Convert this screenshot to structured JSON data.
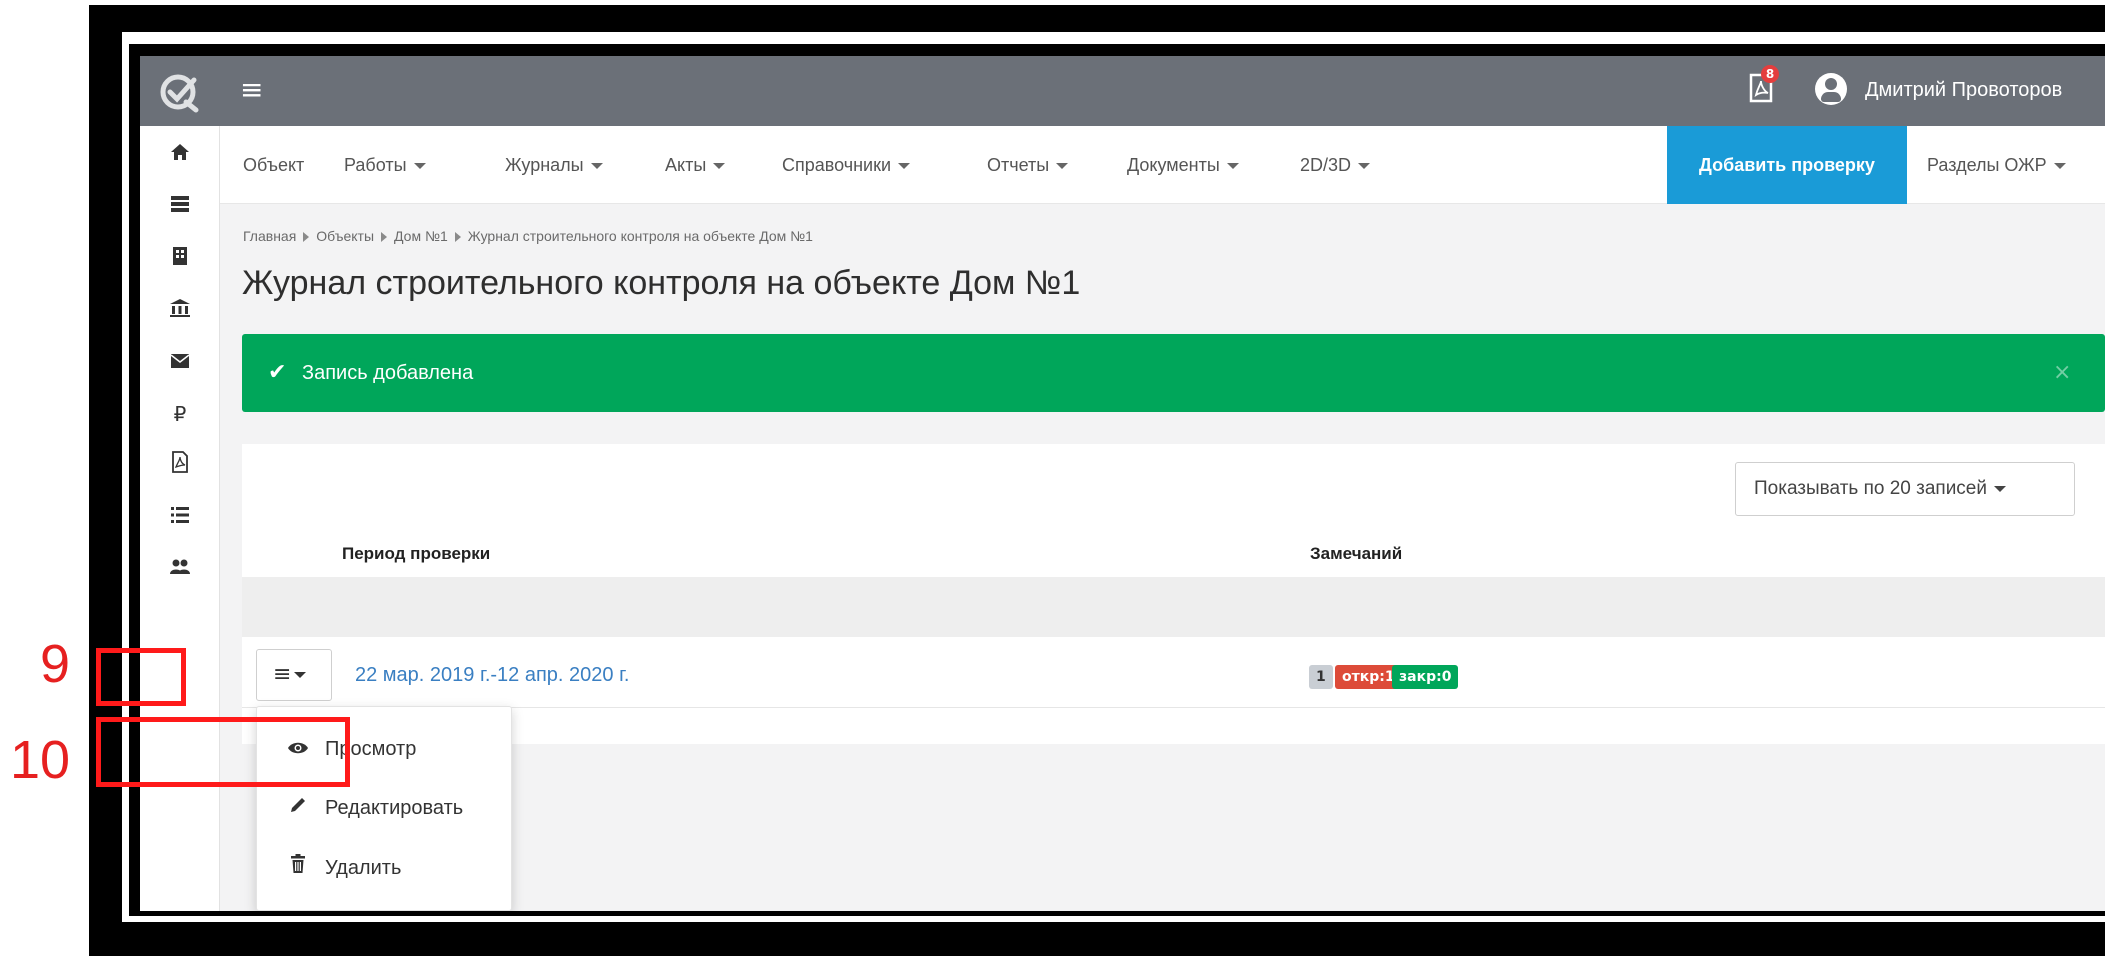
{
  "topbar": {
    "hamburger_icon": "menu-icon",
    "notifications_count": "8",
    "user_name": "Дмитрий Провоторов"
  },
  "nav": {
    "items": [
      "Объект",
      "Работы",
      "Журналы",
      "Акты",
      "Справочники",
      "Отчеты",
      "Документы",
      "2D/3D"
    ],
    "add_check_button": "Добавить проверку",
    "ojr_sections": "Разделы ОЖР"
  },
  "breadcrumb": {
    "items": [
      "Главная",
      "Объекты",
      "Дом №1",
      "Журнал строительного контроля на объекте Дом №1"
    ]
  },
  "page": {
    "title": "Журнал строительного контроля на объекте Дом №1"
  },
  "alert": {
    "text": "Запись добавлена",
    "close": "×",
    "color": "#00a65a"
  },
  "table": {
    "page_size_label": "Показывать по 20 записей",
    "columns": [
      "Период проверки",
      "Замечаний"
    ],
    "rows": [
      {
        "period": "22 мар. 2019 г.-12 апр. 2020 г.",
        "remarks_total": "1",
        "remarks_open": "откр:1",
        "remarks_closed": "закр:0"
      }
    ]
  },
  "row_menu": {
    "items": [
      {
        "icon": "eye-icon",
        "label": "Просмотр"
      },
      {
        "icon": "pencil-icon",
        "label": "Редактировать"
      },
      {
        "icon": "trash-icon",
        "label": "Удалить"
      }
    ]
  },
  "annotations": [
    {
      "number": "9"
    },
    {
      "number": "10"
    }
  ],
  "colors": {
    "topbar": "#6b7078",
    "accent_blue": "#1a9bd7",
    "success_green": "#00a65a",
    "danger_red": "#dd4b39",
    "badge_grey": "#c9ced4",
    "annotation_red": "#ff1a1a"
  }
}
